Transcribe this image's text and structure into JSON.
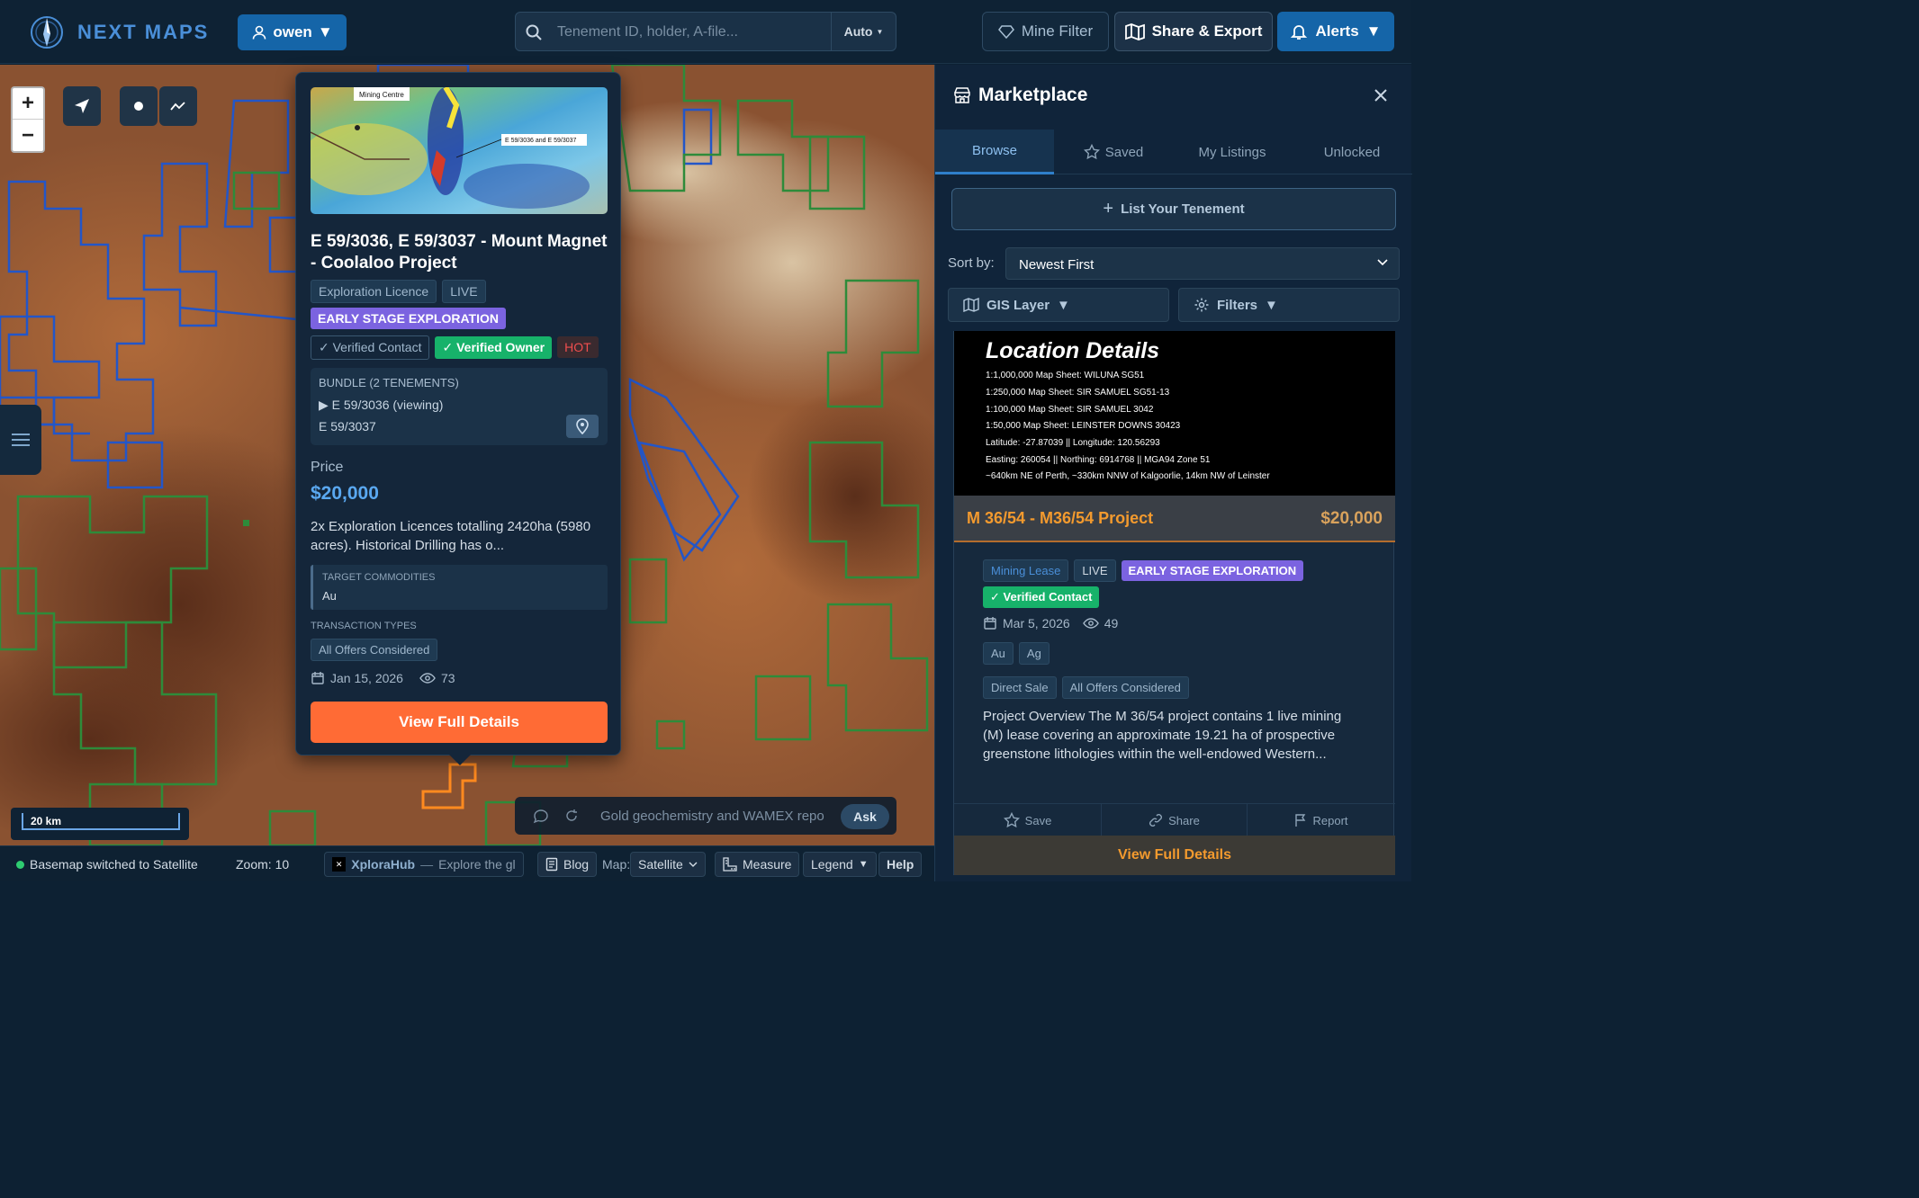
{
  "header": {
    "logo": "NEXT MAPS",
    "user": "owen",
    "search_placeholder": "Tenement ID, holder, A-file...",
    "search_mode": "Auto",
    "mine_filter": "Mine Filter",
    "share_export": "Share & Export",
    "alerts": "Alerts"
  },
  "map": {
    "zoom_in": "+",
    "zoom_out": "−",
    "scale": "20 km",
    "ask_placeholder": "Gold geochemistry and WAMEX repo",
    "ask_button": "Ask"
  },
  "popup": {
    "image_labels": [
      "Mining Centre",
      "E 59/3036 and E 59/3037"
    ],
    "title": "E 59/3036, E 59/3037 - Mount Magnet - Coolaloo Project",
    "tags": [
      "Exploration Licence",
      "LIVE"
    ],
    "stage": "EARLY STAGE EXPLORATION",
    "verified_contact": "✓ Verified Contact",
    "verified_owner": "✓ Verified Owner",
    "hot": "HOT",
    "bundle_header": "BUNDLE (2 TENEMENTS)",
    "bundle_items": [
      "▶ E 59/3036 (viewing)",
      "E 59/3037"
    ],
    "price_label": "Price",
    "price": "$20,000",
    "description": "2x Exploration Licences totalling 2420ha (5980 acres). Historical Drilling has o...",
    "commodities_label": "TARGET COMMODITIES",
    "commodities": "Au",
    "transaction_label": "TRANSACTION TYPES",
    "transaction": "All Offers Considered",
    "date": "Jan 15, 2026",
    "views": "73",
    "view_button": "View Full Details"
  },
  "statusbar": {
    "message": "Basemap switched to Satellite",
    "zoom": "Zoom: 10",
    "hub": "XploraHub",
    "hub_dash": "—",
    "hub_tag": "Explore the glob",
    "blog": "Blog",
    "map_label": "Map:",
    "map_value": "Satellite",
    "measure": "Measure",
    "legend": "Legend",
    "help": "Help"
  },
  "marketplace": {
    "title": "Marketplace",
    "tabs": [
      "Browse",
      "Saved",
      "My Listings",
      "Unlocked"
    ],
    "list_button": "List Your Tenement",
    "sort_label": "Sort by:",
    "sort_value": "Newest First",
    "gis_layer": "GIS Layer",
    "filters": "Filters",
    "card": {
      "image_heading": "Location Details",
      "image_lines": [
        "1:1,000,000 Map Sheet: WILUNA SG51",
        "1:250,000 Map Sheet: SIR SAMUEL SG51-13",
        "1:100,000 Map Sheet: SIR SAMUEL 3042",
        "1:50,000 Map Sheet: LEINSTER DOWNS 30423",
        "Latitude: -27.87039 || Longitude: 120.56293",
        "Easting: 260054 || Northing: 6914768 || MGA94 Zone 51",
        "~640km NE of Perth, ~330km NNW of Kalgoorlie, 14km NW of Leinster"
      ],
      "title": "M 36/54 - M36/54 Project",
      "price": "$20,000",
      "type": "Mining Lease",
      "status": "LIVE",
      "stage": "EARLY STAGE EXPLORATION",
      "verified": "✓ Verified Contact",
      "date": "Mar 5, 2026",
      "views": "49",
      "commodities": [
        "Au",
        "Ag"
      ],
      "transactions": [
        "Direct Sale",
        "All Offers Considered"
      ],
      "description": "Project Overview The M 36/54 project contains 1 live mining (M) lease covering an approximate 19.21 ha of prospective greenstone lithologies within the well-endowed Western...",
      "save": "Save",
      "share": "Share",
      "report": "Report",
      "view_button": "View Full Details"
    }
  },
  "colors": {
    "accent": "#1565a8",
    "orange": "#ff6b35",
    "purple": "#7b63e0",
    "green": "#17b26a",
    "tenement_blue": "#2356c8",
    "tenement_green": "#2e8b3a"
  }
}
